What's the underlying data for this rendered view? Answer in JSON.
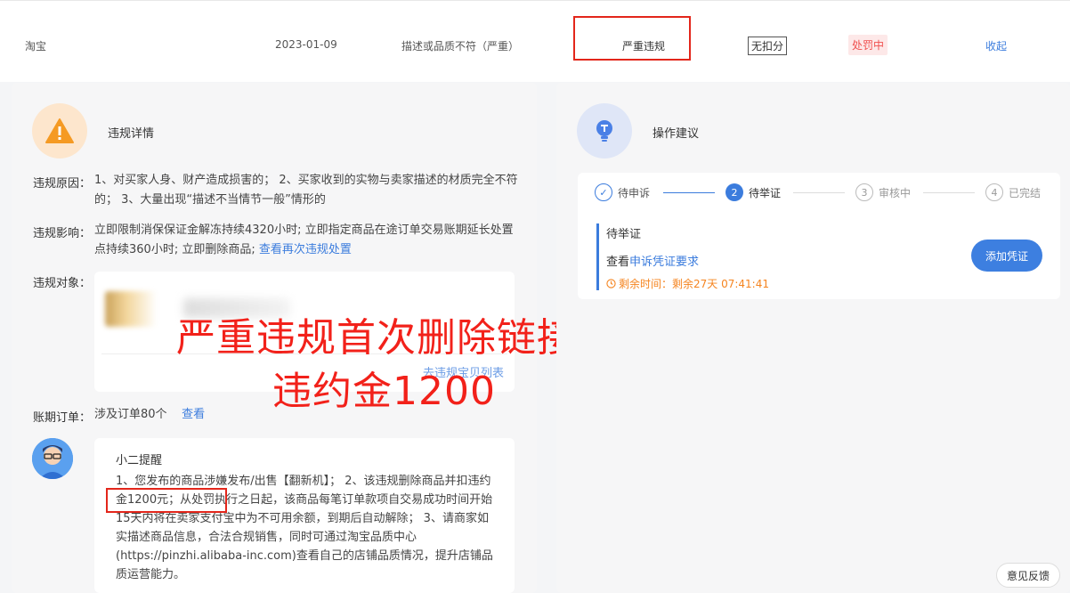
{
  "record": {
    "platform": "淘宝",
    "date": "2023-01-09",
    "reason": "描述或品质不符（严重）",
    "level": "严重违规",
    "deduct": "无扣分",
    "status": "处罚中",
    "collapse": "收起"
  },
  "detail": {
    "title": "违规详情",
    "reason_label": "违规原因：",
    "reason_text": "1、对买家人身、财产造成损害的； 2、买家收到的实物与卖家描述的材质完全不符的； 3、大量出现“描述不当情节一般”情形的",
    "impact_label": "违规影响：",
    "impact_text": "立即限制消保保证金解冻持续4320小时; 立即指定商品在途订单交易账期延长处置点持续360小时; 立即删除商品; ",
    "impact_link": "查看再次违规处置",
    "object_label": "违规对象：",
    "object_link": "去违规宝贝列表",
    "orders_label": "账期订单：",
    "orders_text": "涉及订单80个",
    "orders_link": "查看"
  },
  "overlay": {
    "line1": "严重违规首次删除链接",
    "line2": "违约金1200"
  },
  "reminder": {
    "title": "小二提醒",
    "text": "1、您发布的商品涉嫌发布/出售【翻新机】； 2、该违规删除商品并扣违约金1200元；从处罚执行之日起，该商品每笔订单款项自交易成功时间开始15天内将在卖家支付宝中为不可用余额，到期后自动解除； 3、请商家如实描述商品信息，合法合规销售，同时可通过淘宝品质中心(https://pinzhi.alibaba-inc.com)查看自己的店铺品质情况，提升店铺品质运营能力。"
  },
  "advice": {
    "title": "操作建议",
    "steps": [
      {
        "label": "待申诉",
        "num": "✓"
      },
      {
        "label": "待举证",
        "num": "2"
      },
      {
        "label": "审核中",
        "num": "3"
      },
      {
        "label": "已完结",
        "num": "4"
      }
    ],
    "current_title": "待举证",
    "view_prefix": "查看",
    "view_link": "申诉凭证要求",
    "time_left": "剩余时间：剩余27天 07:41:41",
    "add_button": "添加凭证"
  },
  "feedback": "意见反馈",
  "colors": {
    "accent": "#3b7cdd",
    "danger": "#e3261b",
    "warning": "#f5841f"
  }
}
